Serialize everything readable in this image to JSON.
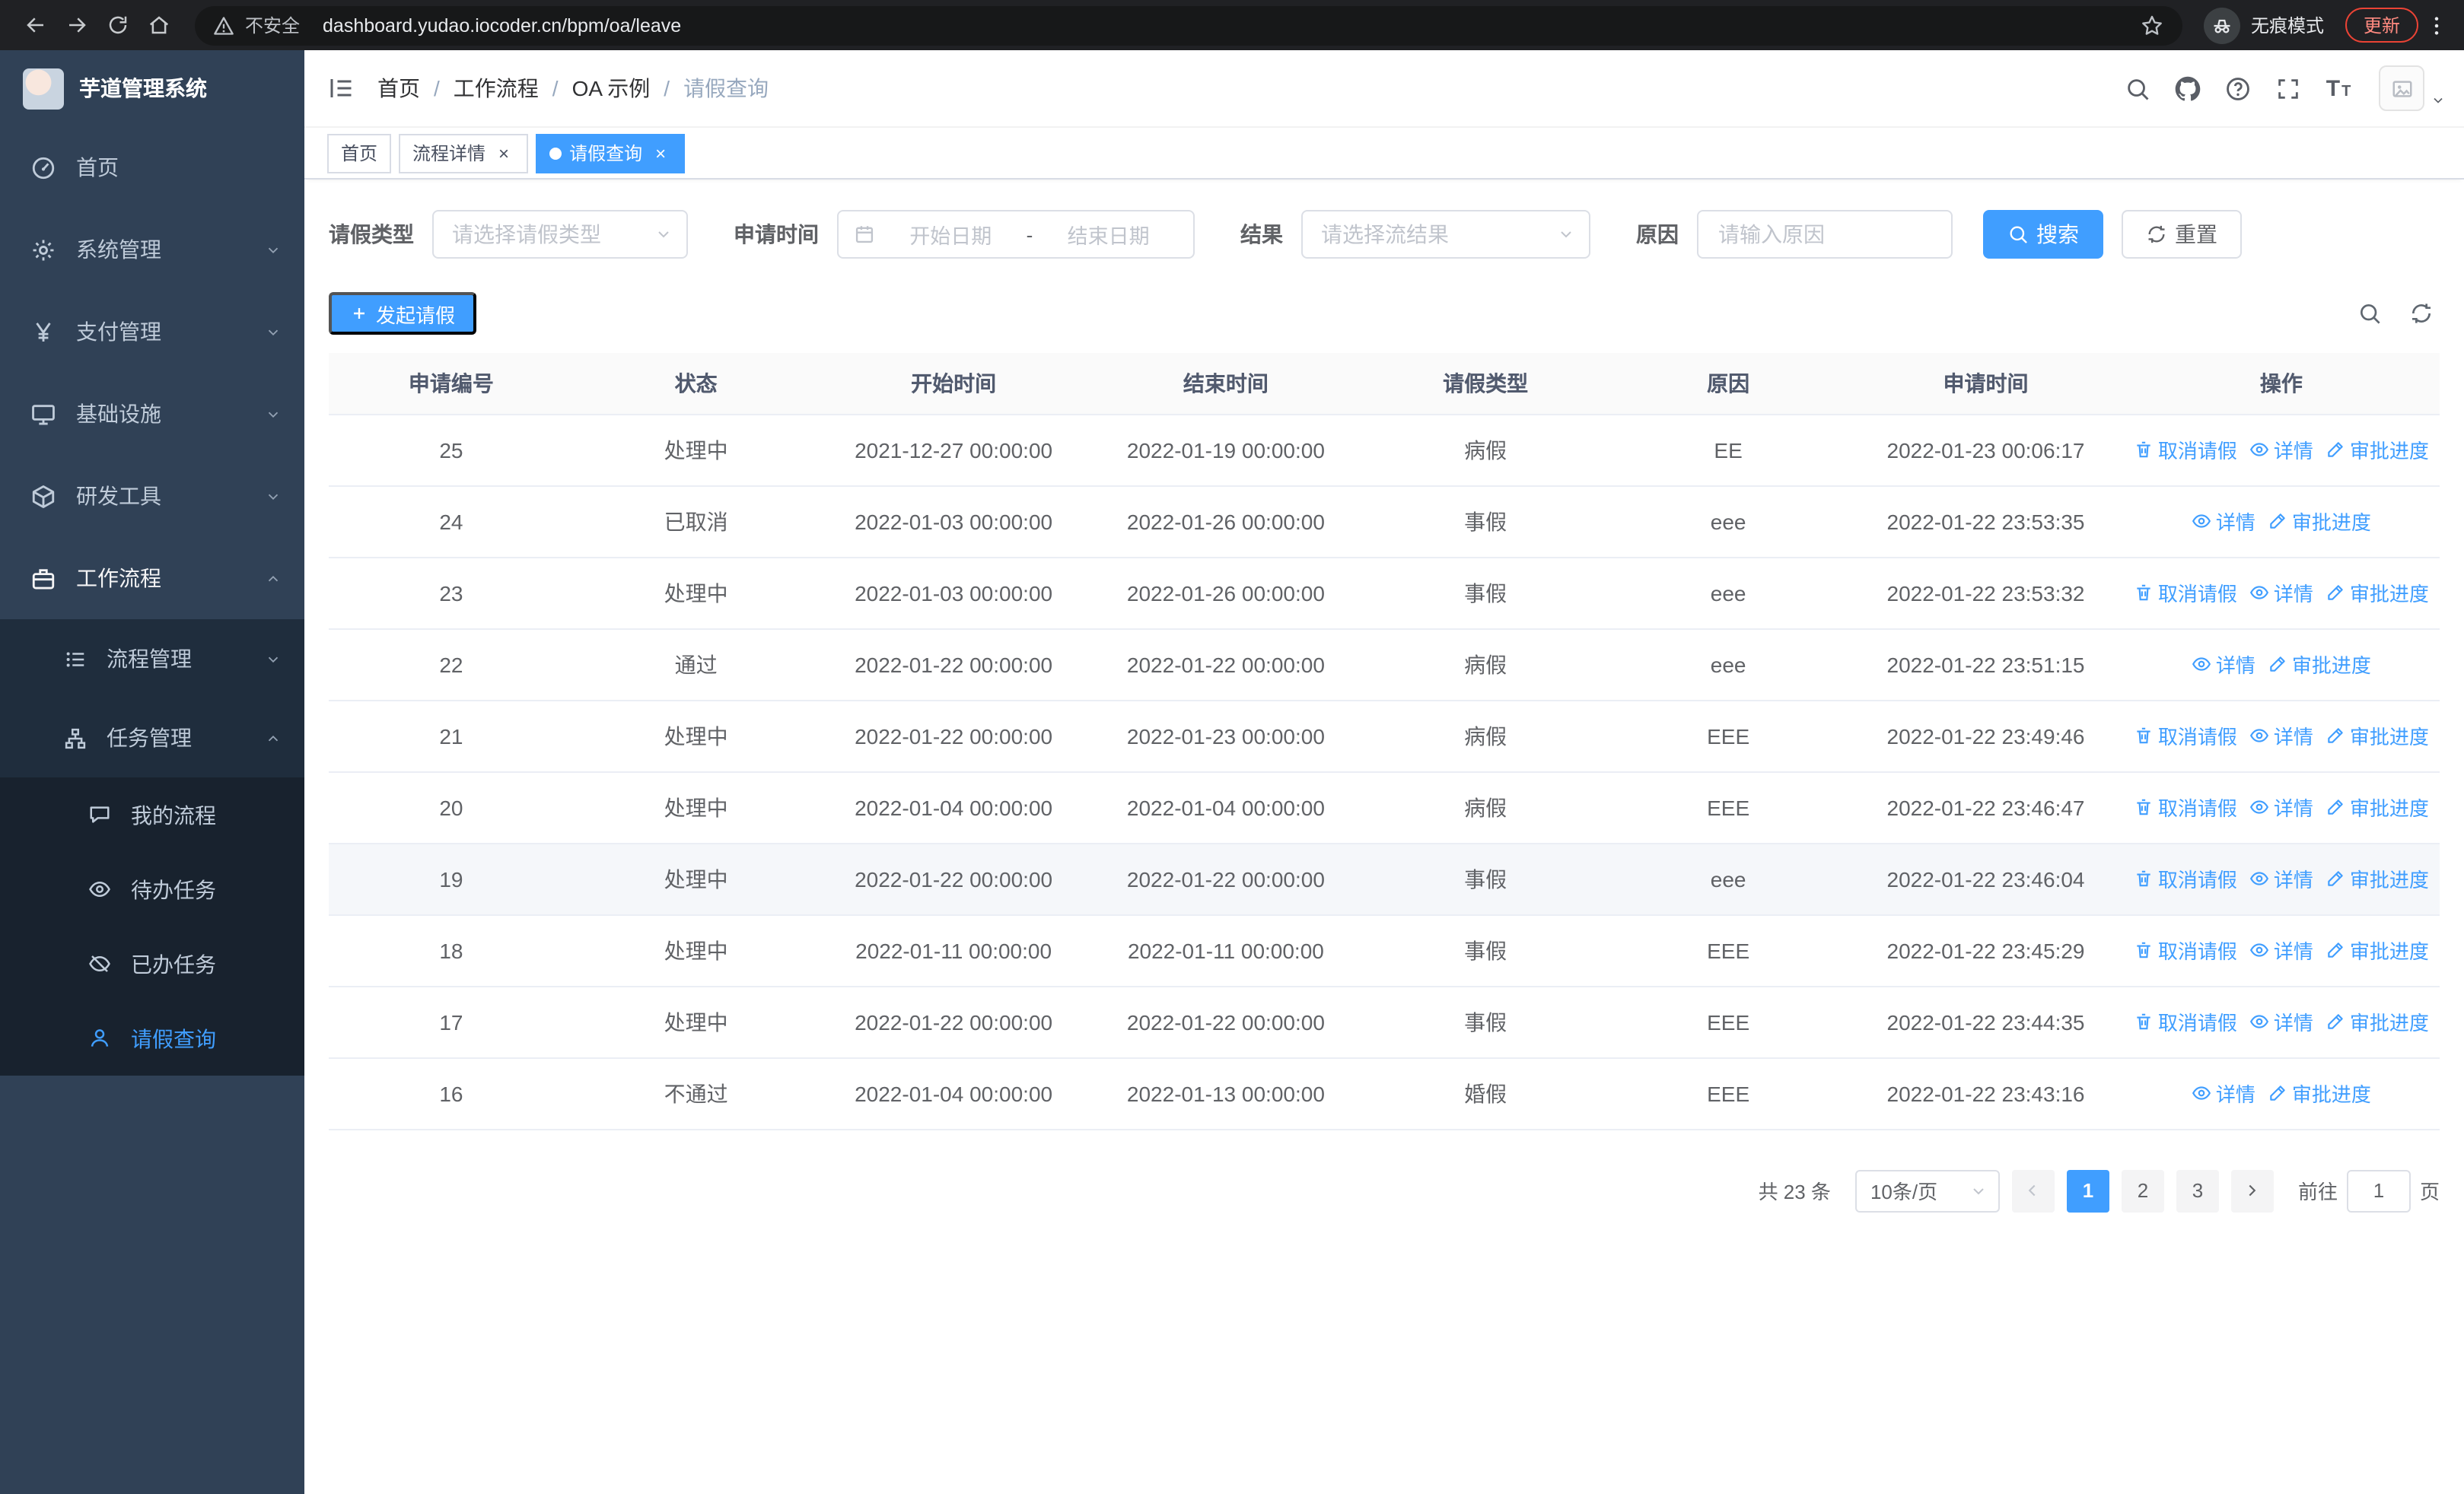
{
  "browser": {
    "security_label": "不安全",
    "url": "dashboard.yudao.iocoder.cn/bpm/oa/leave",
    "incognito_label": "无痕模式",
    "update_label": "更新"
  },
  "sidebar": {
    "app_title": "芋道管理系统",
    "items": [
      {
        "label": "首页"
      },
      {
        "label": "系统管理"
      },
      {
        "label": "支付管理"
      },
      {
        "label": "基础设施"
      },
      {
        "label": "研发工具"
      },
      {
        "label": "工作流程"
      },
      {
        "label": "流程管理"
      },
      {
        "label": "任务管理"
      },
      {
        "label": "我的流程"
      },
      {
        "label": "待办任务"
      },
      {
        "label": "已办任务"
      },
      {
        "label": "请假查询"
      }
    ]
  },
  "header": {
    "breadcrumb": [
      {
        "label": "首页"
      },
      {
        "label": "工作流程"
      },
      {
        "label": "OA 示例"
      },
      {
        "label": "请假查询"
      }
    ]
  },
  "tabs": [
    {
      "label": "首页",
      "closable": false,
      "active": false
    },
    {
      "label": "流程详情",
      "closable": true,
      "active": false
    },
    {
      "label": "请假查询",
      "closable": true,
      "active": true
    }
  ],
  "filters": {
    "leave_type_label": "请假类型",
    "leave_type_placeholder": "请选择请假类型",
    "apply_time_label": "申请时间",
    "start_date_placeholder": "开始日期",
    "date_separator": "-",
    "end_date_placeholder": "结束日期",
    "result_label": "结果",
    "result_placeholder": "请选择流结果",
    "reason_label": "原因",
    "reason_placeholder": "请输入原因",
    "search_button": "搜索",
    "reset_button": "重置"
  },
  "toolbar": {
    "create_label": "发起请假"
  },
  "table": {
    "columns": [
      "申请编号",
      "状态",
      "开始时间",
      "结束时间",
      "请假类型",
      "原因",
      "申请时间",
      "操作"
    ],
    "action_labels": {
      "cancel": "取消请假",
      "detail": "详情",
      "progress": "审批进度"
    },
    "rows": [
      {
        "id": "25",
        "status": "处理中",
        "start": "2021-12-27 00:00:00",
        "end": "2022-01-19 00:00:00",
        "type": "病假",
        "reason": "EE",
        "applied": "2022-01-23 00:06:17",
        "actions": [
          "cancel",
          "detail",
          "progress"
        ],
        "highlight": false
      },
      {
        "id": "24",
        "status": "已取消",
        "start": "2022-01-03 00:00:00",
        "end": "2022-01-26 00:00:00",
        "type": "事假",
        "reason": "eee",
        "applied": "2022-01-22 23:53:35",
        "actions": [
          "detail",
          "progress"
        ],
        "highlight": false
      },
      {
        "id": "23",
        "status": "处理中",
        "start": "2022-01-03 00:00:00",
        "end": "2022-01-26 00:00:00",
        "type": "事假",
        "reason": "eee",
        "applied": "2022-01-22 23:53:32",
        "actions": [
          "cancel",
          "detail",
          "progress"
        ],
        "highlight": false
      },
      {
        "id": "22",
        "status": "通过",
        "start": "2022-01-22 00:00:00",
        "end": "2022-01-22 00:00:00",
        "type": "病假",
        "reason": "eee",
        "applied": "2022-01-22 23:51:15",
        "actions": [
          "detail",
          "progress"
        ],
        "highlight": false
      },
      {
        "id": "21",
        "status": "处理中",
        "start": "2022-01-22 00:00:00",
        "end": "2022-01-23 00:00:00",
        "type": "病假",
        "reason": "EEE",
        "applied": "2022-01-22 23:49:46",
        "actions": [
          "cancel",
          "detail",
          "progress"
        ],
        "highlight": false
      },
      {
        "id": "20",
        "status": "处理中",
        "start": "2022-01-04 00:00:00",
        "end": "2022-01-04 00:00:00",
        "type": "病假",
        "reason": "EEE",
        "applied": "2022-01-22 23:46:47",
        "actions": [
          "cancel",
          "detail",
          "progress"
        ],
        "highlight": false
      },
      {
        "id": "19",
        "status": "处理中",
        "start": "2022-01-22 00:00:00",
        "end": "2022-01-22 00:00:00",
        "type": "事假",
        "reason": "eee",
        "applied": "2022-01-22 23:46:04",
        "actions": [
          "cancel",
          "detail",
          "progress"
        ],
        "highlight": true
      },
      {
        "id": "18",
        "status": "处理中",
        "start": "2022-01-11 00:00:00",
        "end": "2022-01-11 00:00:00",
        "type": "事假",
        "reason": "EEE",
        "applied": "2022-01-22 23:45:29",
        "actions": [
          "cancel",
          "detail",
          "progress"
        ],
        "highlight": false
      },
      {
        "id": "17",
        "status": "处理中",
        "start": "2022-01-22 00:00:00",
        "end": "2022-01-22 00:00:00",
        "type": "事假",
        "reason": "EEE",
        "applied": "2022-01-22 23:44:35",
        "actions": [
          "cancel",
          "detail",
          "progress"
        ],
        "highlight": false
      },
      {
        "id": "16",
        "status": "不通过",
        "start": "2022-01-04 00:00:00",
        "end": "2022-01-13 00:00:00",
        "type": "婚假",
        "reason": "EEE",
        "applied": "2022-01-22 23:43:16",
        "actions": [
          "detail",
          "progress"
        ],
        "highlight": false
      }
    ]
  },
  "pagination": {
    "total_label": "共 23 条",
    "page_size_label": "10条/页",
    "pages": [
      "1",
      "2",
      "3"
    ],
    "active_page": "1",
    "goto_label": "前往",
    "goto_value": "1",
    "goto_unit": "页"
  },
  "colors": {
    "primary": "#409eff",
    "sidebar_bg": "#304156",
    "submenu_bg": "#1f2d3d",
    "submenu_deep_bg": "#18222e",
    "browser_bar_bg": "#202124",
    "update_badge": "#ea4335",
    "table_border": "#ebeef5"
  },
  "icons": {
    "search-icon": "magnifier",
    "github-icon": "octocat",
    "help-icon": "question-circle",
    "fullscreen-icon": "expand-corners",
    "font-size-icon": "TT",
    "refresh-icon": "circular-arrows",
    "calendar-icon": "calendar",
    "cancel-icon": "trash",
    "detail-icon": "eye",
    "progress-icon": "pen"
  }
}
